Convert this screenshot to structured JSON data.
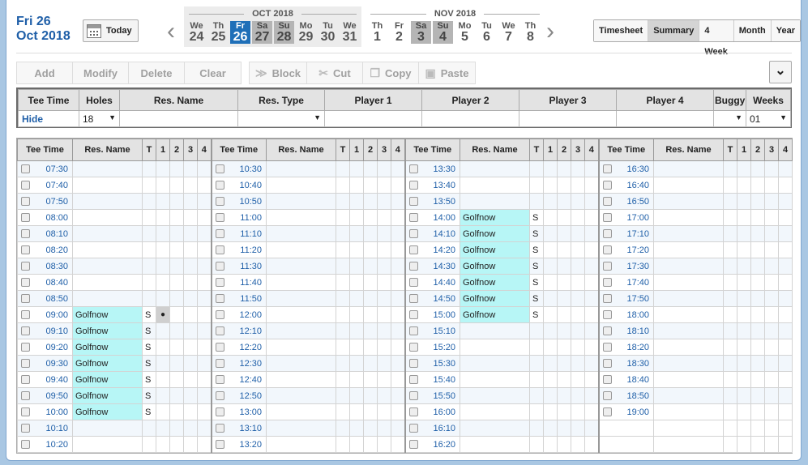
{
  "header": {
    "date_line1": "Fri 26",
    "date_line2": "Oct 2018",
    "today_label": "Today"
  },
  "calendar": {
    "oct_label": "OCT 2018",
    "nov_label": "NOV 2018",
    "days": [
      {
        "dw": "We",
        "dn": "24",
        "type": "normal"
      },
      {
        "dw": "Th",
        "dn": "25",
        "type": "normal"
      },
      {
        "dw": "Fr",
        "dn": "26",
        "type": "selected"
      },
      {
        "dw": "Sa",
        "dn": "27",
        "type": "weekend"
      },
      {
        "dw": "Su",
        "dn": "28",
        "type": "weekend"
      },
      {
        "dw": "Mo",
        "dn": "29",
        "type": "normal"
      },
      {
        "dw": "Tu",
        "dn": "30",
        "type": "normal"
      },
      {
        "dw": "We",
        "dn": "31",
        "type": "normal"
      },
      {
        "dw": "Th",
        "dn": "1",
        "type": "normal"
      },
      {
        "dw": "Fr",
        "dn": "2",
        "type": "normal"
      },
      {
        "dw": "Sa",
        "dn": "3",
        "type": "weekend"
      },
      {
        "dw": "Su",
        "dn": "4",
        "type": "weekend"
      },
      {
        "dw": "Mo",
        "dn": "5",
        "type": "normal"
      },
      {
        "dw": "Tu",
        "dn": "6",
        "type": "normal"
      },
      {
        "dw": "We",
        "dn": "7",
        "type": "normal"
      },
      {
        "dw": "Th",
        "dn": "8",
        "type": "normal"
      }
    ]
  },
  "views": [
    "Timesheet",
    "Summary",
    "4 Week",
    "Month",
    "Year"
  ],
  "active_view": "Summary",
  "toolbar": {
    "add": "Add",
    "modify": "Modify",
    "delete": "Delete",
    "clear": "Clear",
    "block": "Block",
    "cut": "Cut",
    "copy": "Copy",
    "paste": "Paste"
  },
  "entry": {
    "headers": [
      "Tee Time",
      "Holes",
      "Res. Name",
      "Res. Type",
      "Player 1",
      "Player 2",
      "Player 3",
      "Player 4",
      "Buggy",
      "Weeks"
    ],
    "hide_label": "Hide",
    "holes_value": "18",
    "weeks_value": "01"
  },
  "grid": {
    "headers": [
      "Tee Time",
      "Res. Name",
      "T",
      "1",
      "2",
      "3",
      "4"
    ],
    "columns": [
      [
        {
          "t": "07:30"
        },
        {
          "t": "07:40"
        },
        {
          "t": "07:50"
        },
        {
          "t": "08:00"
        },
        {
          "t": "08:10"
        },
        {
          "t": "08:20"
        },
        {
          "t": "08:30"
        },
        {
          "t": "08:40"
        },
        {
          "t": "08:50"
        },
        {
          "t": "09:00",
          "n": "Golfnow",
          "ty": "S",
          "dot": true
        },
        {
          "t": "09:10",
          "n": "Golfnow",
          "ty": "S"
        },
        {
          "t": "09:20",
          "n": "Golfnow",
          "ty": "S"
        },
        {
          "t": "09:30",
          "n": "Golfnow",
          "ty": "S"
        },
        {
          "t": "09:40",
          "n": "Golfnow",
          "ty": "S"
        },
        {
          "t": "09:50",
          "n": "Golfnow",
          "ty": "S"
        },
        {
          "t": "10:00",
          "n": "Golfnow",
          "ty": "S"
        },
        {
          "t": "10:10"
        },
        {
          "t": "10:20"
        }
      ],
      [
        {
          "t": "10:30"
        },
        {
          "t": "10:40"
        },
        {
          "t": "10:50"
        },
        {
          "t": "11:00"
        },
        {
          "t": "11:10"
        },
        {
          "t": "11:20"
        },
        {
          "t": "11:30"
        },
        {
          "t": "11:40"
        },
        {
          "t": "11:50"
        },
        {
          "t": "12:00"
        },
        {
          "t": "12:10"
        },
        {
          "t": "12:20"
        },
        {
          "t": "12:30"
        },
        {
          "t": "12:40"
        },
        {
          "t": "12:50"
        },
        {
          "t": "13:00"
        },
        {
          "t": "13:10"
        },
        {
          "t": "13:20"
        }
      ],
      [
        {
          "t": "13:30"
        },
        {
          "t": "13:40"
        },
        {
          "t": "13:50"
        },
        {
          "t": "14:00",
          "n": "Golfnow",
          "ty": "S"
        },
        {
          "t": "14:10",
          "n": "Golfnow",
          "ty": "S"
        },
        {
          "t": "14:20",
          "n": "Golfnow",
          "ty": "S"
        },
        {
          "t": "14:30",
          "n": "Golfnow",
          "ty": "S"
        },
        {
          "t": "14:40",
          "n": "Golfnow",
          "ty": "S"
        },
        {
          "t": "14:50",
          "n": "Golfnow",
          "ty": "S"
        },
        {
          "t": "15:00",
          "n": "Golfnow",
          "ty": "S"
        },
        {
          "t": "15:10"
        },
        {
          "t": "15:20"
        },
        {
          "t": "15:30"
        },
        {
          "t": "15:40"
        },
        {
          "t": "15:50"
        },
        {
          "t": "16:00"
        },
        {
          "t": "16:10"
        },
        {
          "t": "16:20"
        }
      ],
      [
        {
          "t": "16:30"
        },
        {
          "t": "16:40"
        },
        {
          "t": "16:50"
        },
        {
          "t": "17:00"
        },
        {
          "t": "17:10"
        },
        {
          "t": "17:20"
        },
        {
          "t": "17:30"
        },
        {
          "t": "17:40"
        },
        {
          "t": "17:50"
        },
        {
          "t": "18:00"
        },
        {
          "t": "18:10"
        },
        {
          "t": "18:20"
        },
        {
          "t": "18:30"
        },
        {
          "t": "18:40"
        },
        {
          "t": "18:50"
        },
        {
          "t": "19:00"
        },
        {
          "t": null
        },
        {
          "t": null
        }
      ]
    ]
  },
  "dot_symbol": "●"
}
